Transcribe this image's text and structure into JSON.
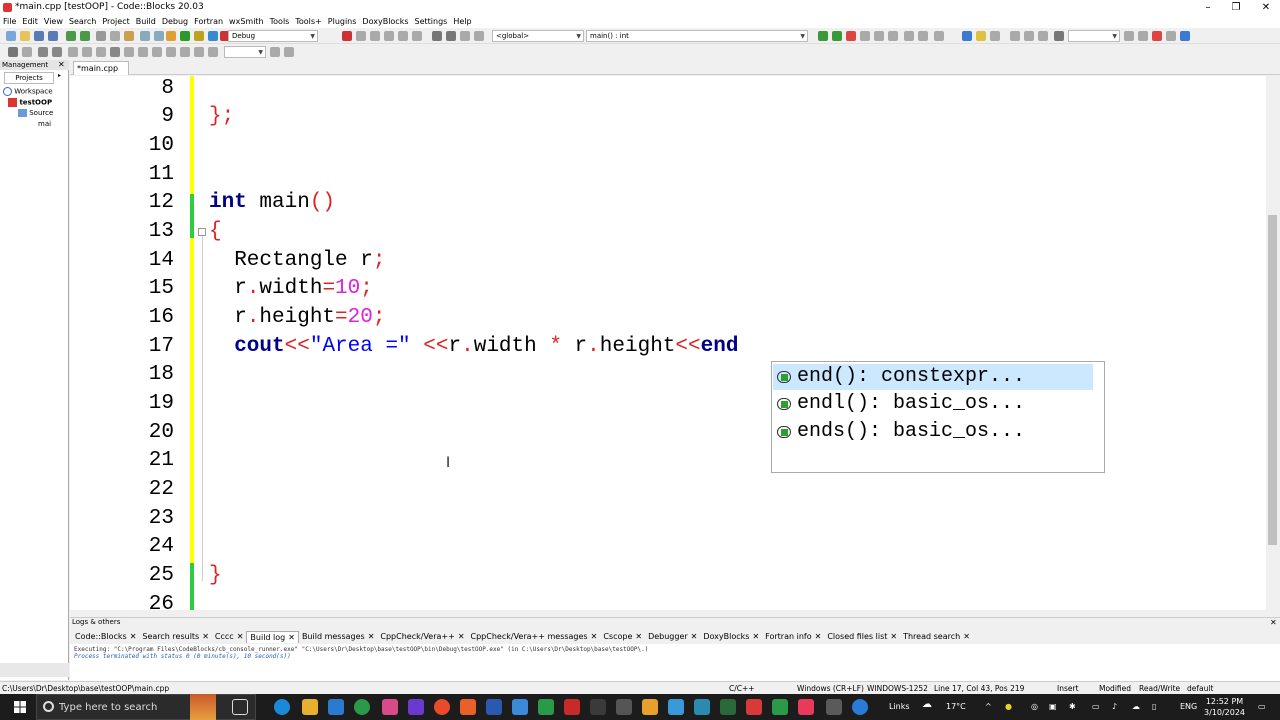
{
  "window": {
    "title": "*main.cpp [testOOP] - Code::Blocks 20.03",
    "minimize": "–",
    "maximize": "❐",
    "close": "✕"
  },
  "menu": [
    "File",
    "Edit",
    "View",
    "Search",
    "Project",
    "Build",
    "Debug",
    "Fortran",
    "wxSmith",
    "Tools",
    "Tools+",
    "Plugins",
    "DoxyBlocks",
    "Settings",
    "Help"
  ],
  "toolbar": {
    "build_target": "Debug",
    "scope": "<global>",
    "function": "main() : int",
    "find_value": ""
  },
  "management": {
    "title": "Management",
    "tab": "Projects",
    "tree": {
      "workspace": "Workspace",
      "project": "testOOP",
      "sources": "Source",
      "file": "mai"
    }
  },
  "editor": {
    "file_tab": "*main.cpp",
    "lines": [
      {
        "n": "8"
      },
      {
        "n": "9"
      },
      {
        "n": "10"
      },
      {
        "n": "11"
      },
      {
        "n": "12"
      },
      {
        "n": "13"
      },
      {
        "n": "14"
      },
      {
        "n": "15"
      },
      {
        "n": "16"
      },
      {
        "n": "17"
      },
      {
        "n": "18"
      },
      {
        "n": "19"
      },
      {
        "n": "20"
      },
      {
        "n": "21"
      },
      {
        "n": "22"
      },
      {
        "n": "23"
      },
      {
        "n": "24"
      },
      {
        "n": "25"
      },
      {
        "n": "26"
      }
    ],
    "code": {
      "l9_brace": "}",
      "l9_semi": ";",
      "l12_kw": "int",
      "l12_rest": " main",
      "l12_paren": "()",
      "l13": "{",
      "l14_a": "  Rectangle r",
      "l14_b": ";",
      "l15_a": "  r",
      "l15_dot": ".",
      "l15_b": "width",
      "l15_eq": "=",
      "l15_num": "10",
      "l15_semi": ";",
      "l16_a": "  r",
      "l16_dot": ".",
      "l16_b": "height",
      "l16_eq": "=",
      "l16_num": "20",
      "l16_semi": ";",
      "l17_kw": "  cout",
      "l17_op": "<<",
      "l17_str": "\"Area =\"",
      "l17_sp": " ",
      "l17_op2": "<<",
      "l17_r": "r",
      "l17_dot": ".",
      "l17_w": "width ",
      "l17_mul": "*",
      "l17_r2": " r",
      "l17_dot2": ".",
      "l17_h": "height",
      "l17_op3": "<<",
      "l17_end": "end",
      "l25": "}"
    }
  },
  "autocomplete": [
    {
      "text": "end(): constexpr...",
      "selected": true
    },
    {
      "text": "endl(): basic_os...",
      "selected": false
    },
    {
      "text": "ends(): basic_os...",
      "selected": false
    }
  ],
  "logs": {
    "title": "Logs & others",
    "tabs": [
      "Code::Blocks",
      "Search results",
      "Cccc",
      "Build log",
      "Build messages",
      "CppCheck/Vera++",
      "CppCheck/Vera++ messages",
      "Cscope",
      "Debugger",
      "DoxyBlocks",
      "Fortran info",
      "Closed files list",
      "Thread search"
    ],
    "active_tab": "Build log",
    "output": [
      "Executing: \"C:\\Program Files\\CodeBlocks/cb_console_runner.exe\" \"C:\\Users\\Dr\\Desktop\\base\\testOOP\\bin\\Debug\\testOOP.exe\"  (in C:\\Users\\Dr\\Desktop\\base\\testOOP\\.)",
      "Process terminated with status 0 (0 minute(s), 10 second(s))"
    ]
  },
  "status": {
    "path": "C:\\Users\\Dr\\Desktop\\base\\testOOP\\main.cpp",
    "lang": "C/C++",
    "eol": "Windows (CR+LF)",
    "encoding": "WINDOWS-1252",
    "position": "Line 17, Col 43, Pos 219",
    "mode": "Insert",
    "modified": "Modified",
    "access": "Read/Write",
    "profile": "default"
  },
  "taskbar": {
    "search_placeholder": "Type here to search",
    "links": "Links",
    "weather": "17°C",
    "lang": "ENG",
    "time": "12:52 PM",
    "date": "3/10/2024"
  }
}
